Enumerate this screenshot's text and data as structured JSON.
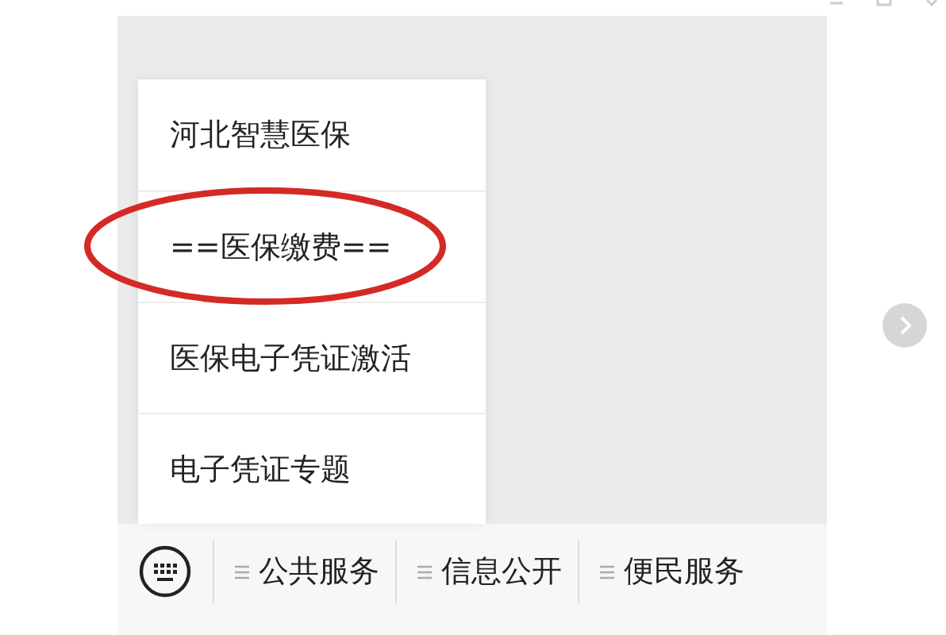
{
  "popup_menu": {
    "items": [
      {
        "label": "河北智慧医保",
        "circled": false
      },
      {
        "label": "==医保缴费==",
        "circled": true
      },
      {
        "label": "医保电子凭证激活",
        "circled": false
      },
      {
        "label": "电子凭证专题",
        "circled": false
      }
    ]
  },
  "bottom_menu": [
    {
      "label": "公共服务"
    },
    {
      "label": "信息公开"
    },
    {
      "label": "便民服务"
    }
  ]
}
